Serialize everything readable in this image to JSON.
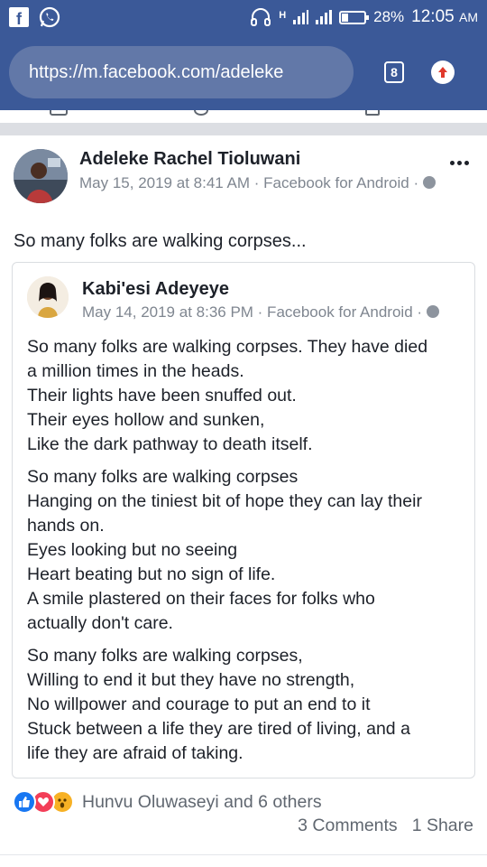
{
  "status_bar": {
    "battery": "28%",
    "time": "12:05",
    "ampm": "AM",
    "network": "H",
    "battery_level": 0.28
  },
  "browser": {
    "url": "https://m.facebook.com/adeleke",
    "tab_count": "8"
  },
  "post": {
    "author": "Adeleke Rachel Tioluwani",
    "timestamp": "May 15, 2019 at 8:41 AM · Facebook for Android ·",
    "text": "So many folks are walking corpses...",
    "shared": {
      "author": "Kabi'esi Adeyeye",
      "timestamp": "May 14, 2019 at 8:36 PM · Facebook for Android ·",
      "stanzas": [
        [
          "So many folks are walking corpses. They have died",
          "a million times in the heads.",
          "Their lights have been snuffed out.",
          "Their eyes hollow and sunken,",
          "Like the dark pathway to death itself."
        ],
        [
          "So many folks are walking corpses",
          "Hanging on the tiniest bit of hope they can lay their",
          "hands on.",
          "Eyes looking but no seeing",
          "Heart beating but no sign of life.",
          "A smile plastered on their faces for folks who",
          "actually don't care."
        ],
        [
          "So many folks are walking corpses,",
          "Willing to end it but they have no strength,",
          "No willpower and courage to put an end to it",
          "Stuck between a life they are tired of living, and a",
          "life they are afraid of taking."
        ]
      ]
    },
    "reactions_text": "Hunvu Oluwaseyi and 6 others",
    "comments": "3 Comments",
    "shares": "1 Share"
  }
}
